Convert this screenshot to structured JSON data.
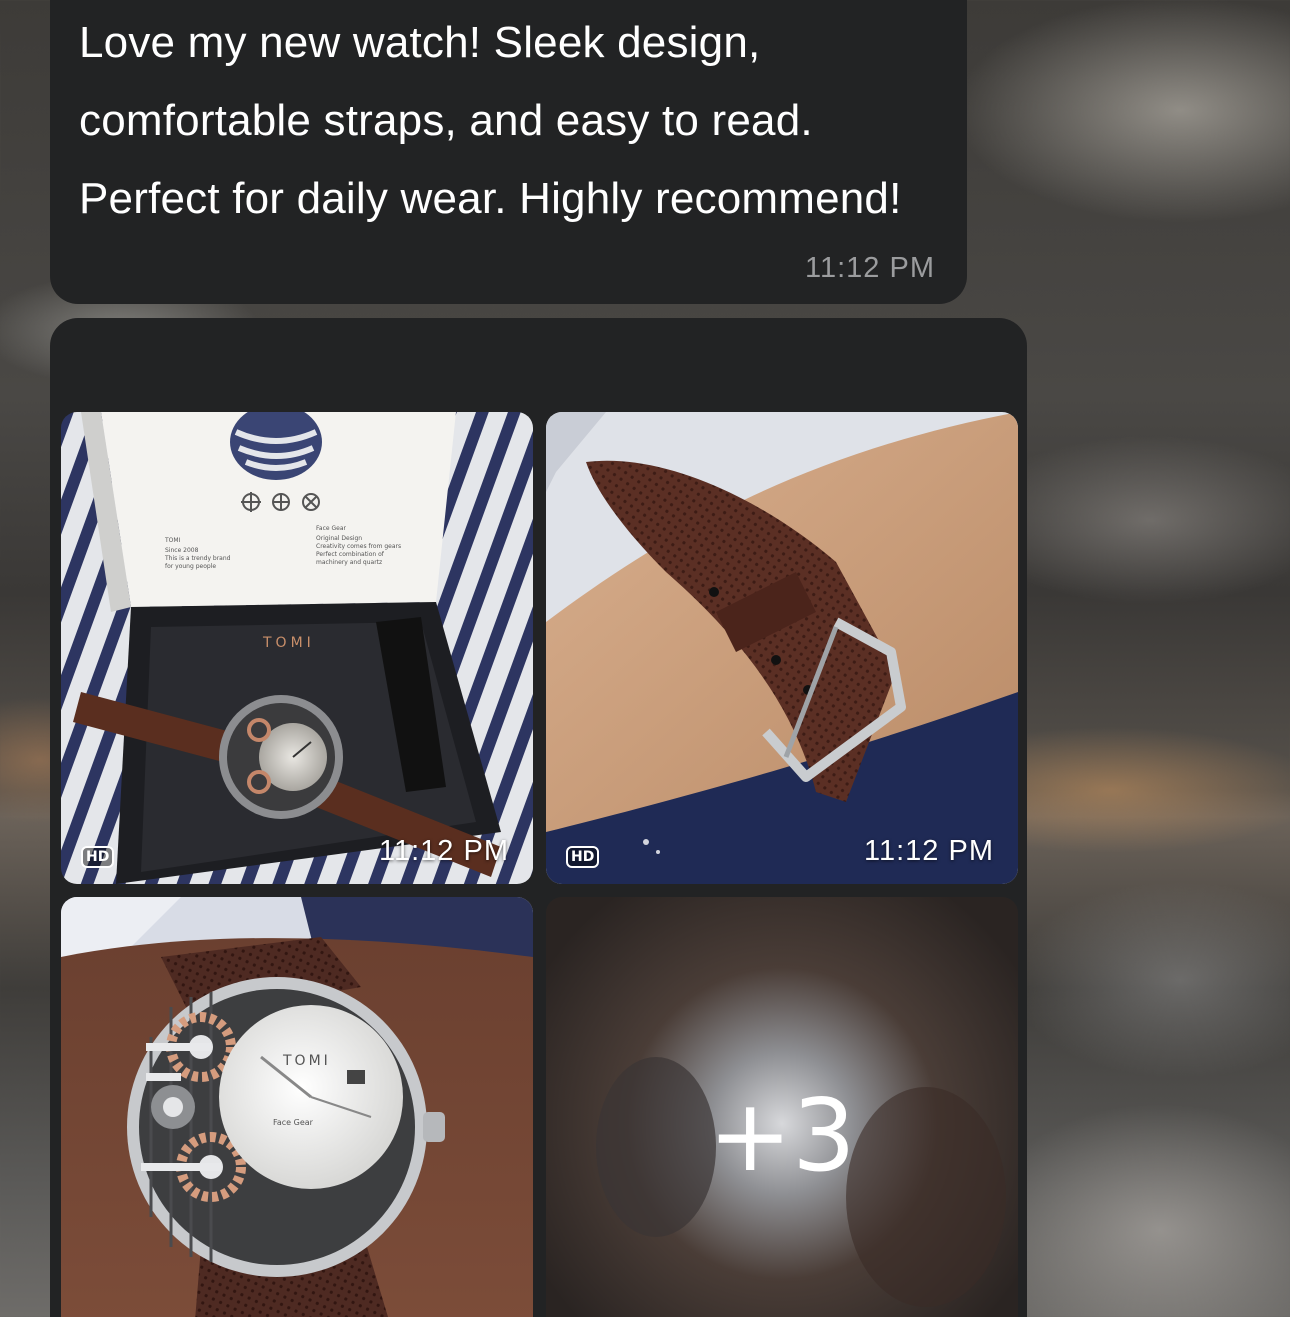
{
  "text_message": {
    "body": "Love my new watch! Sleek design,\ncomfortable straps, and easy to read.\nPerfect for daily wear. Highly recommend!",
    "time": "11:12 PM"
  },
  "album": {
    "tiles": [
      {
        "badge": "HD",
        "time": "11:12 PM",
        "box_brand": "TOMI",
        "box_left_text": "TOMI\nSince 2008\nThis is a trendy brand\nfor young people",
        "box_right_text": "Face Gear\nOriginal Design\nCreativity comes from gears\nPerfect combination of\nmachinery and quartz"
      },
      {
        "badge": "HD",
        "time": "11:12 PM"
      },
      {
        "dial_brand": "TOMI",
        "dial_sub": "Face Gear"
      },
      {
        "more_count": "+3"
      }
    ]
  }
}
